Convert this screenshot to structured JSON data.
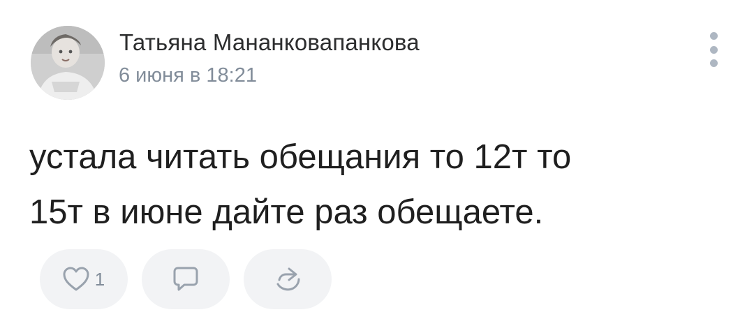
{
  "post": {
    "author_name": "Татьяна Мананковапанкова",
    "date": "6 июня в 18:21",
    "text_line1": "устала читать обещания то 12т то",
    "text_line2": "15т в июне дайте раз обещаете.",
    "like_count": "1"
  },
  "icons": {
    "avatar": "user-avatar-photo",
    "menu": "more-vertical-icon",
    "like": "heart-outline-icon",
    "comment": "comment-icon",
    "share": "share-arrow-icon"
  },
  "colors": {
    "author": "#2c2d2e",
    "secondary_text": "#818c99",
    "button_background": "#f2f3f5",
    "icon": "#99a2ad",
    "menu_dots": "#aeb7c2"
  }
}
